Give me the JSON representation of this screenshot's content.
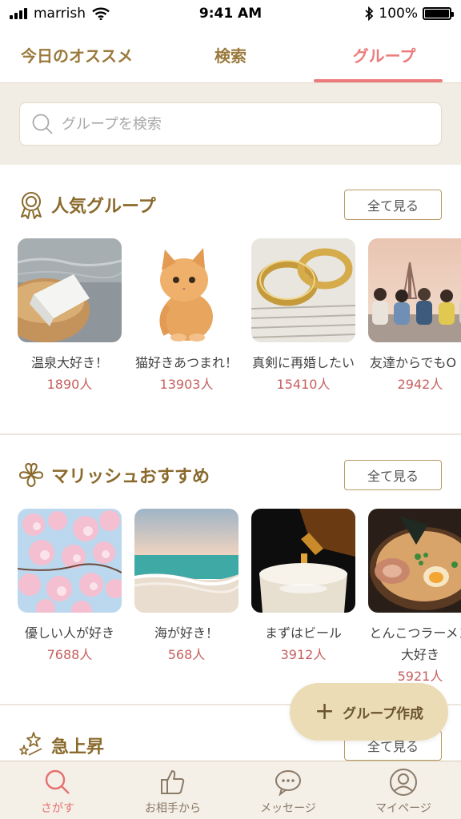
{
  "status": {
    "carrier": "marrish",
    "time": "9:41 AM",
    "battery": "100%"
  },
  "tabs": [
    {
      "label": "今日のオススメ"
    },
    {
      "label": "検索"
    },
    {
      "label": "グループ"
    }
  ],
  "search": {
    "placeholder": "グループを検索"
  },
  "sections": {
    "popular": {
      "title": "人気グループ",
      "see_all": "全て見る",
      "groups": [
        {
          "name": "温泉大好き！",
          "count": "1890人"
        },
        {
          "name": "猫好きあつまれ！",
          "count": "13903人"
        },
        {
          "name": "真剣に再婚したい",
          "count": "15410人"
        },
        {
          "name": "友達からでもO",
          "count": "2942人"
        }
      ]
    },
    "recommended": {
      "title": "マリッシュおすすめ",
      "see_all": "全て見る",
      "groups": [
        {
          "name": "優しい人が好き",
          "count": "7688人"
        },
        {
          "name": "海が好き！",
          "count": "568人"
        },
        {
          "name": "まずはビール",
          "count": "3912人"
        },
        {
          "name": "とんこつラーメン大好き",
          "count": "5921人"
        }
      ]
    },
    "rising": {
      "title": "急上昇",
      "see_all": "全て見る"
    }
  },
  "fab": {
    "label": "グループ作成"
  },
  "bottom_nav": [
    {
      "label": "さがす",
      "icon": "search-icon"
    },
    {
      "label": "お相手から",
      "icon": "thumbs-up-icon"
    },
    {
      "label": "メッセージ",
      "icon": "chat-icon"
    },
    {
      "label": "マイページ",
      "icon": "person-icon"
    }
  ],
  "colors": {
    "accent": "#ec7c7c",
    "brand": "#8a6a2c",
    "count": "#c65f5f",
    "fab": "#ecdcb6"
  }
}
